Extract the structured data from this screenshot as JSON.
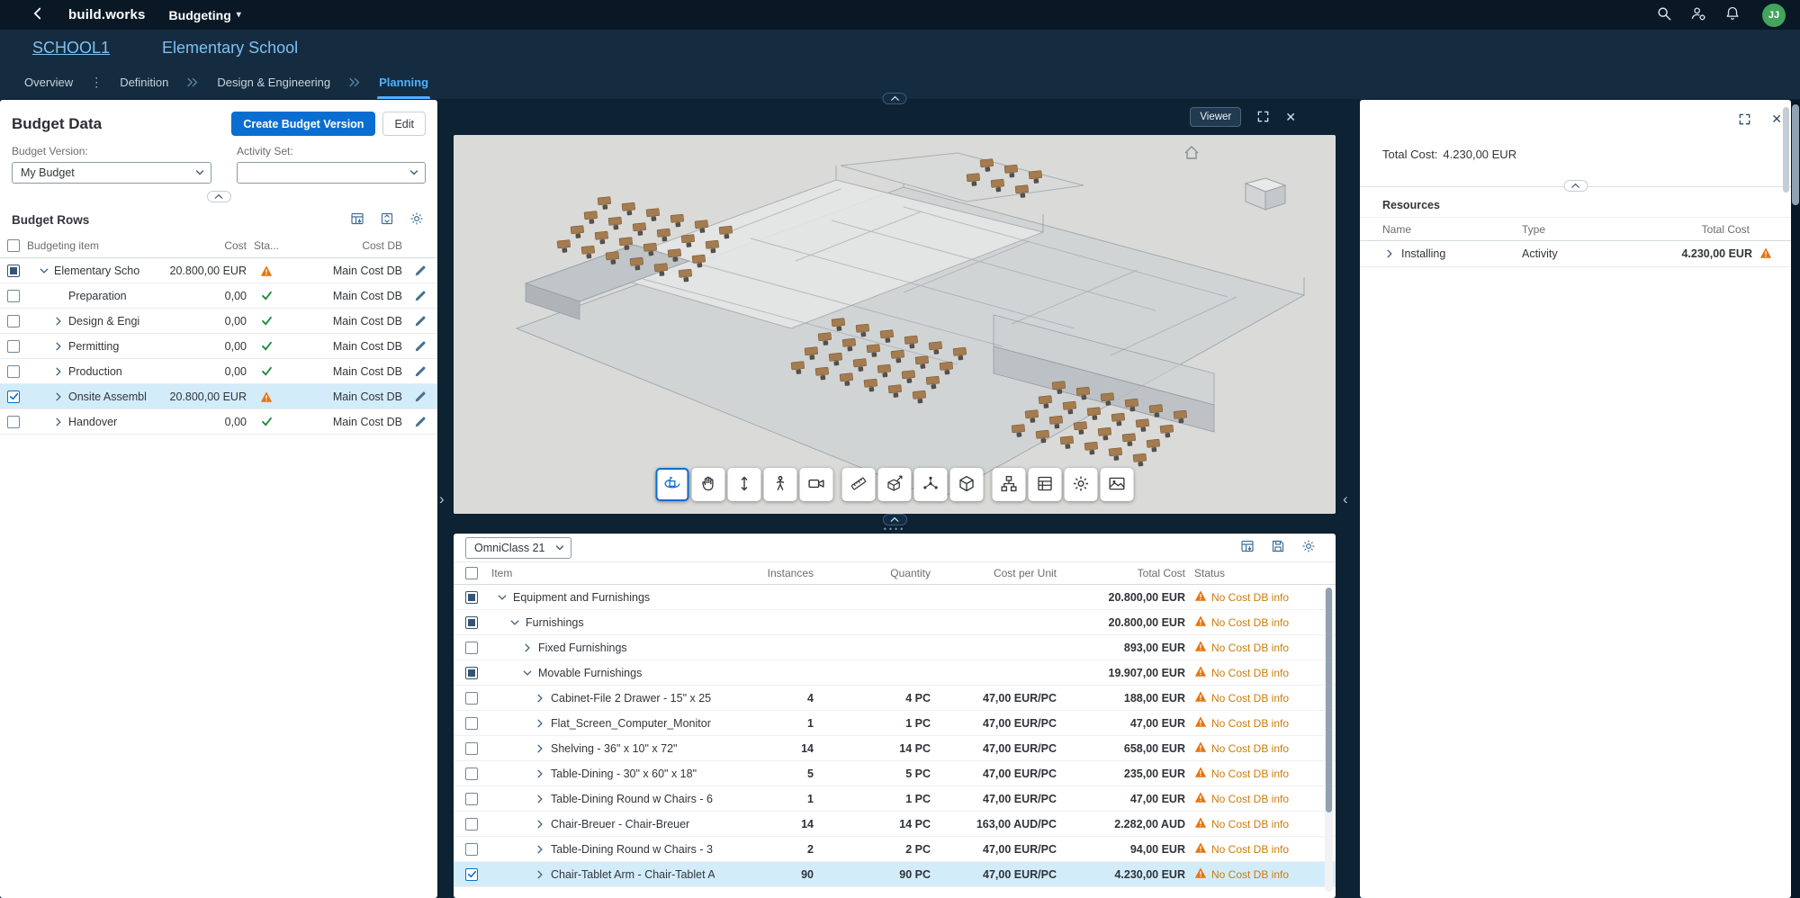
{
  "topbar": {
    "brand": "build.works",
    "module": "Budgeting",
    "avatar_initials": "JJ"
  },
  "page_header": {
    "project_code": "SCHOOL1",
    "project_name": "Elementary School"
  },
  "tabs": {
    "items": [
      "Overview",
      "Definition",
      "Design & Engineering",
      "Planning"
    ],
    "active": "Planning"
  },
  "icons": {
    "caret-down": "▾",
    "overflow-dots": "⋮",
    "close": "✕",
    "chevron-right": "›",
    "chevron-left": "‹",
    "drag-dots": "••••"
  },
  "colors": {
    "accent": "#0a6ed1",
    "active_tab": "#4db1ff",
    "warning": "#e9730c",
    "warning_text": "#cb7d0a",
    "success": "#1e8a3c",
    "selection": "#d2ecfa",
    "avatar": "#43a45e",
    "topbar": "#0a1826",
    "background": "#0d2233"
  },
  "budget_panel": {
    "title": "Budget Data",
    "create_version_button": "Create Budget Version",
    "edit_button": "Edit",
    "budget_version_label": "Budget Version:",
    "budget_version_value": "My Budget",
    "activity_set_label": "Activity Set:",
    "activity_set_value": "",
    "rows_section_title": "Budget Rows",
    "toolbar_icons": [
      "export-table",
      "expand-rows",
      "settings"
    ],
    "columns": {
      "item": "Budgeting item",
      "cost": "Cost",
      "status": "Sta...",
      "cost_db": "Cost DB"
    },
    "rows": [
      {
        "label": "Elementary Scho",
        "cost": "20.800,00 EUR",
        "status": "warning",
        "cost_db": "Main Cost DB",
        "expand": "open",
        "checkbox": "mixed",
        "level": 0,
        "selected": false
      },
      {
        "label": "Preparation",
        "cost": "0,00",
        "status": "ok",
        "cost_db": "Main Cost DB",
        "expand": "none",
        "checkbox": "off",
        "level": 1,
        "selected": false
      },
      {
        "label": "Design & Engi",
        "cost": "0,00",
        "status": "ok",
        "cost_db": "Main Cost DB",
        "expand": "closed",
        "checkbox": "off",
        "level": 1,
        "selected": false
      },
      {
        "label": "Permitting",
        "cost": "0,00",
        "status": "ok",
        "cost_db": "Main Cost DB",
        "expand": "closed",
        "checkbox": "off",
        "level": 1,
        "selected": false
      },
      {
        "label": "Production",
        "cost": "0,00",
        "status": "ok",
        "cost_db": "Main Cost DB",
        "expand": "closed",
        "checkbox": "off",
        "level": 1,
        "selected": false
      },
      {
        "label": "Onsite Assembl",
        "cost": "20.800,00 EUR",
        "status": "warning",
        "cost_db": "Main Cost DB",
        "expand": "closed",
        "checkbox": "on",
        "level": 1,
        "selected": true
      },
      {
        "label": "Handover",
        "cost": "0,00",
        "status": "ok",
        "cost_db": "Main Cost DB",
        "expand": "closed",
        "checkbox": "off",
        "level": 1,
        "selected": false
      }
    ]
  },
  "viewer": {
    "mode_button": "Viewer",
    "active_tool": "orbit",
    "toolbar_groups": [
      [
        "orbit",
        "pan",
        "zoom",
        "first-person",
        "camera"
      ],
      [
        "measure",
        "section",
        "explode",
        "model"
      ],
      [
        "hierarchy",
        "sheet",
        "settings",
        "render"
      ]
    ]
  },
  "items_panel": {
    "classification_selector": "OmniClass 21",
    "toolbar_icons": [
      "export-table",
      "save-view",
      "settings"
    ],
    "columns": [
      "Item",
      "Instances",
      "Quantity",
      "Cost per Unit",
      "Total Cost",
      "Status"
    ],
    "status_text": "No Cost DB info",
    "rows": [
      {
        "label": "Equipment and Furnishings",
        "level": 0,
        "expand": "open",
        "checkbox": "mixed",
        "instances": "",
        "quantity": "",
        "cost_per_unit": "",
        "total_cost": "20.800,00 EUR",
        "selected": false
      },
      {
        "label": "Furnishings",
        "level": 1,
        "expand": "open",
        "checkbox": "mixed",
        "instances": "",
        "quantity": "",
        "cost_per_unit": "",
        "total_cost": "20.800,00 EUR",
        "selected": false
      },
      {
        "label": "Fixed Furnishings",
        "level": 2,
        "expand": "closed",
        "checkbox": "off",
        "instances": "",
        "quantity": "",
        "cost_per_unit": "",
        "total_cost": "893,00 EUR",
        "selected": false
      },
      {
        "label": "Movable Furnishings",
        "level": 2,
        "expand": "open",
        "checkbox": "mixed",
        "instances": "",
        "quantity": "",
        "cost_per_unit": "",
        "total_cost": "19.907,00 EUR",
        "selected": false
      },
      {
        "label": "Cabinet-File 2 Drawer - 15\" x 25",
        "level": 3,
        "expand": "closed",
        "checkbox": "off",
        "instances": "4",
        "quantity": "4 PC",
        "cost_per_unit": "47,00 EUR/PC",
        "total_cost": "188,00 EUR",
        "selected": false
      },
      {
        "label": "Flat_Screen_Computer_Monitor",
        "level": 3,
        "expand": "closed",
        "checkbox": "off",
        "instances": "1",
        "quantity": "1 PC",
        "cost_per_unit": "47,00 EUR/PC",
        "total_cost": "47,00 EUR",
        "selected": false
      },
      {
        "label": "Shelving - 36\" x 10\" x 72\"",
        "level": 3,
        "expand": "closed",
        "checkbox": "off",
        "instances": "14",
        "quantity": "14 PC",
        "cost_per_unit": "47,00 EUR/PC",
        "total_cost": "658,00 EUR",
        "selected": false
      },
      {
        "label": "Table-Dining - 30\" x 60\" x 18\"",
        "level": 3,
        "expand": "closed",
        "checkbox": "off",
        "instances": "5",
        "quantity": "5 PC",
        "cost_per_unit": "47,00 EUR/PC",
        "total_cost": "235,00 EUR",
        "selected": false
      },
      {
        "label": "Table-Dining Round w Chairs - 6",
        "level": 3,
        "expand": "closed",
        "checkbox": "off",
        "instances": "1",
        "quantity": "1 PC",
        "cost_per_unit": "47,00 EUR/PC",
        "total_cost": "47,00 EUR",
        "selected": false
      },
      {
        "label": "Chair-Breuer - Chair-Breuer",
        "level": 3,
        "expand": "closed",
        "checkbox": "off",
        "instances": "14",
        "quantity": "14 PC",
        "cost_per_unit": "163,00 AUD/PC",
        "total_cost": "2.282,00 AUD",
        "selected": false
      },
      {
        "label": "Table-Dining Round w Chairs - 3",
        "level": 3,
        "expand": "closed",
        "checkbox": "off",
        "instances": "2",
        "quantity": "2 PC",
        "cost_per_unit": "47,00 EUR/PC",
        "total_cost": "94,00 EUR",
        "selected": false
      },
      {
        "label": "Chair-Tablet Arm - Chair-Tablet A",
        "level": 3,
        "expand": "closed",
        "checkbox": "on",
        "instances": "90",
        "quantity": "90 PC",
        "cost_per_unit": "47,00 EUR/PC",
        "total_cost": "4.230,00 EUR",
        "selected": true
      }
    ]
  },
  "resources_panel": {
    "total_cost_label": "Total Cost:",
    "total_cost_value": "4.230,00 EUR",
    "section_title": "Resources",
    "columns": [
      "Name",
      "Type",
      "Total Cost"
    ],
    "rows": [
      {
        "name": "Installing",
        "type": "Activity",
        "total_cost": "4.230,00 EUR",
        "status": "warning",
        "expand": "closed"
      }
    ]
  }
}
